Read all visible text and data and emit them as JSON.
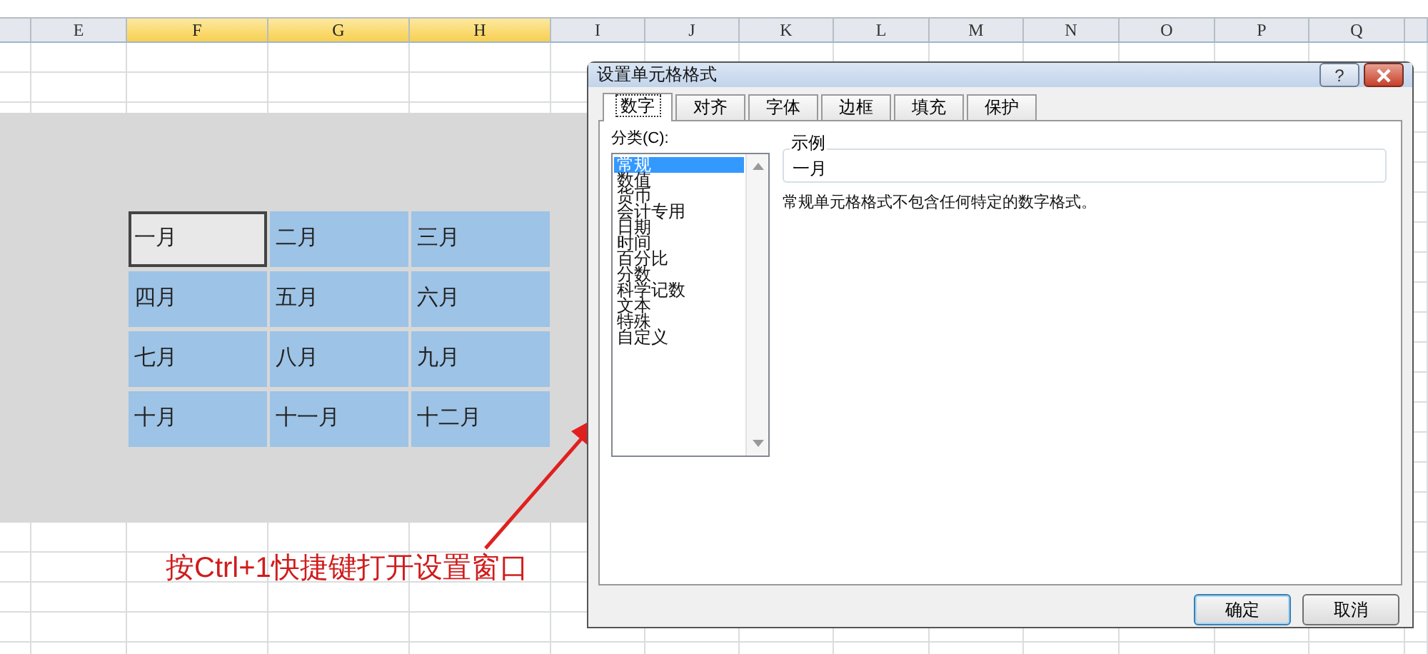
{
  "sheet": {
    "columns": [
      {
        "label": "E",
        "selected": false
      },
      {
        "label": "F",
        "selected": true
      },
      {
        "label": "G",
        "selected": true
      },
      {
        "label": "H",
        "selected": true
      },
      {
        "label": "I",
        "selected": false
      },
      {
        "label": "J",
        "selected": false
      },
      {
        "label": "K",
        "selected": false
      },
      {
        "label": "L",
        "selected": false
      },
      {
        "label": "M",
        "selected": false
      },
      {
        "label": "N",
        "selected": false
      },
      {
        "label": "O",
        "selected": false
      },
      {
        "label": "P",
        "selected": false
      },
      {
        "label": "Q",
        "selected": false
      }
    ],
    "cells": [
      {
        "text": "一月",
        "active": true
      },
      {
        "text": "二月",
        "active": false
      },
      {
        "text": "三月",
        "active": false
      },
      {
        "text": "四月",
        "active": false
      },
      {
        "text": "五月",
        "active": false
      },
      {
        "text": "六月",
        "active": false
      },
      {
        "text": "七月",
        "active": false
      },
      {
        "text": "八月",
        "active": false
      },
      {
        "text": "九月",
        "active": false
      },
      {
        "text": "十月",
        "active": false
      },
      {
        "text": "十一月",
        "active": false
      },
      {
        "text": "十二月",
        "active": false
      }
    ]
  },
  "annotation": "按Ctrl+1快捷键打开设置窗口",
  "dialog": {
    "title": "设置单元格格式",
    "help": "?",
    "tabs": [
      {
        "label": "数字",
        "selected": true
      },
      {
        "label": "对齐",
        "selected": false
      },
      {
        "label": "字体",
        "selected": false
      },
      {
        "label": "边框",
        "selected": false
      },
      {
        "label": "填充",
        "selected": false
      },
      {
        "label": "保护",
        "selected": false
      }
    ],
    "category_label": "分类(C):",
    "categories": [
      {
        "label": "常规",
        "selected": true
      },
      {
        "label": "数值",
        "selected": false
      },
      {
        "label": "货币",
        "selected": false
      },
      {
        "label": "会计专用",
        "selected": false
      },
      {
        "label": "日期",
        "selected": false
      },
      {
        "label": "时间",
        "selected": false
      },
      {
        "label": "百分比",
        "selected": false
      },
      {
        "label": "分数",
        "selected": false
      },
      {
        "label": "科学记数",
        "selected": false
      },
      {
        "label": "文本",
        "selected": false
      },
      {
        "label": "特殊",
        "selected": false
      },
      {
        "label": "自定义",
        "selected": false
      }
    ],
    "sample_label": "示例",
    "sample_value": "一月",
    "description": "常规单元格格式不包含任何特定的数字格式。",
    "buttons": [
      {
        "label": "确定",
        "default": true
      },
      {
        "label": "取消",
        "default": false
      }
    ]
  }
}
